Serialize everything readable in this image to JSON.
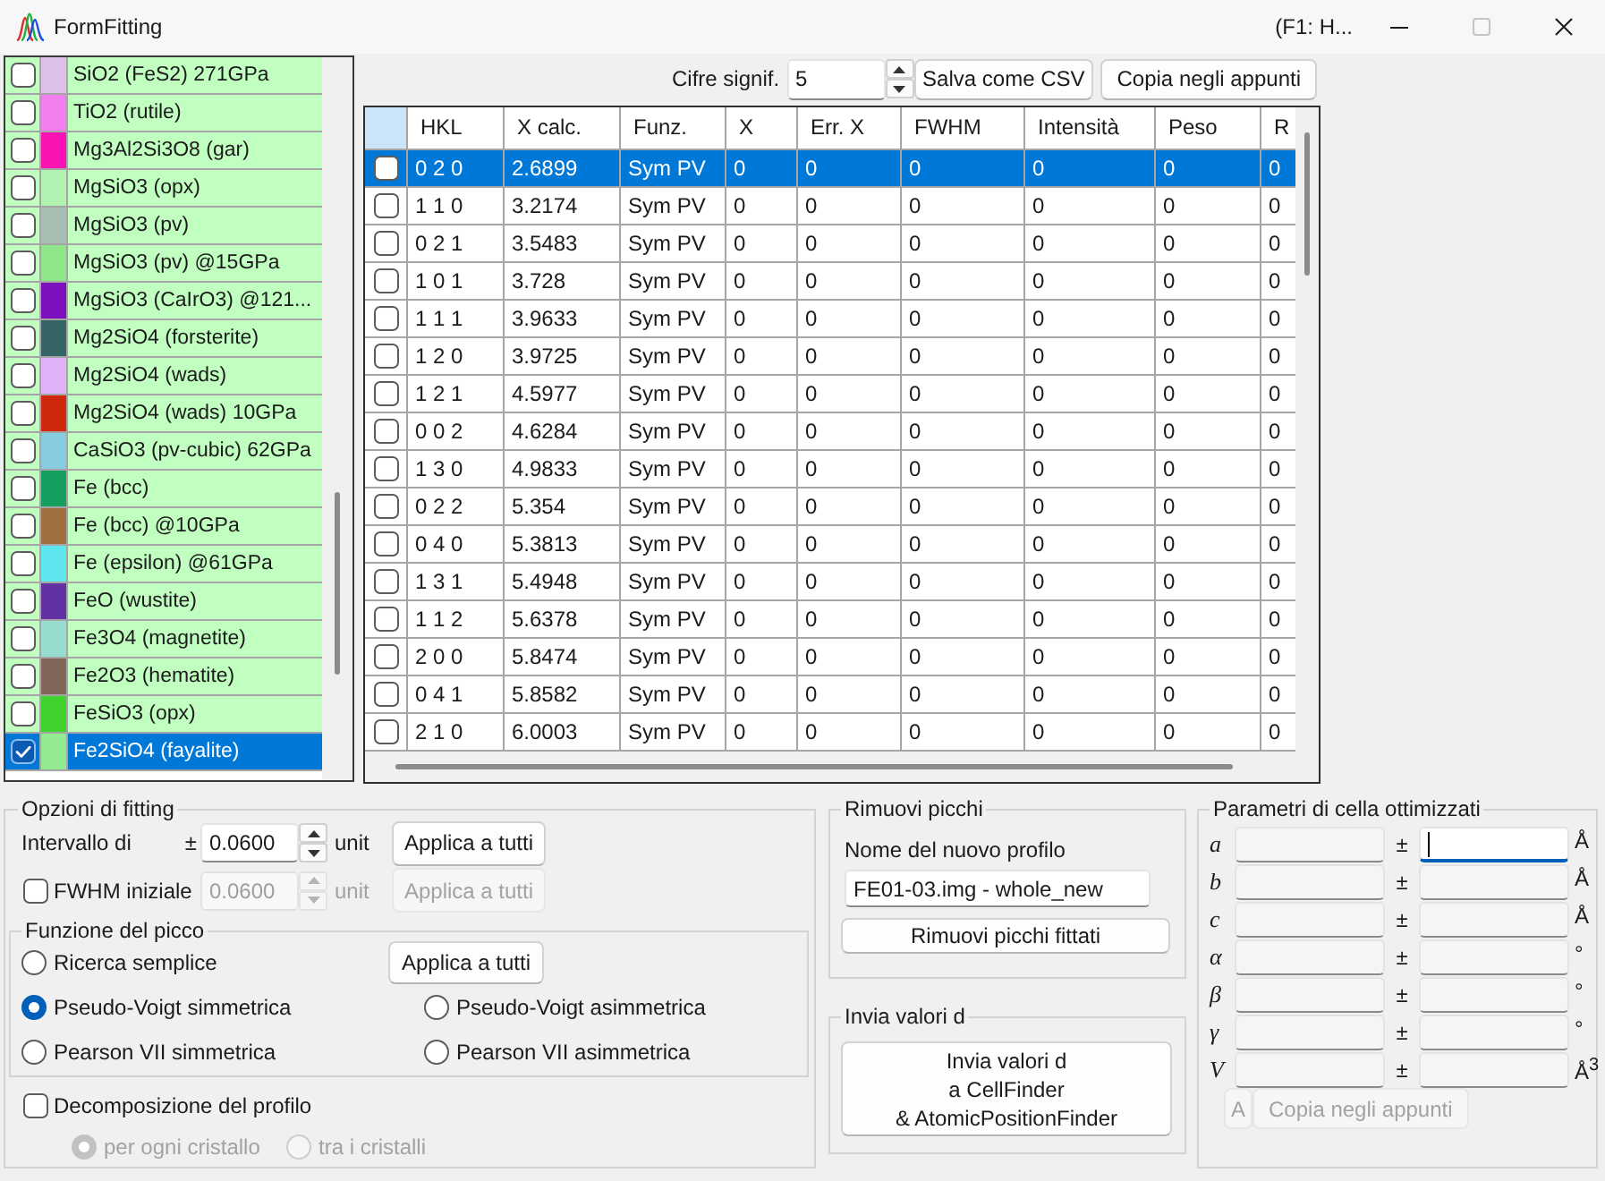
{
  "window": {
    "title": "FormFitting",
    "help_hint": "(F1: H...",
    "maximize_disabled": true
  },
  "crystal_list": {
    "items": [
      {
        "name": "SiO2 (FeS2) 271GPa",
        "color": "#dcc0e8",
        "checked": false,
        "selected": false
      },
      {
        "name": "TiO2 (rutile)",
        "color": "#f27ff0",
        "checked": false,
        "selected": false
      },
      {
        "name": "Mg3Al2Si3O8 (gar)",
        "color": "#fa14b4",
        "checked": false,
        "selected": false
      },
      {
        "name": "MgSiO3 (opx)",
        "color": "#b2f2b0",
        "checked": false,
        "selected": false
      },
      {
        "name": "MgSiO3 (pv)",
        "color": "#a6beb2",
        "checked": false,
        "selected": false
      },
      {
        "name": "MgSiO3 (pv) @15GPa",
        "color": "#90e68a",
        "checked": false,
        "selected": false
      },
      {
        "name": "MgSiO3 (CaIrO3) @121...",
        "color": "#7c10bc",
        "checked": false,
        "selected": false
      },
      {
        "name": "Mg2SiO4 (forsterite)",
        "color": "#346464",
        "checked": false,
        "selected": false
      },
      {
        "name": "Mg2SiO4 (wads)",
        "color": "#e2b2f8",
        "checked": false,
        "selected": false
      },
      {
        "name": "Mg2SiO4 (wads) 10GPa",
        "color": "#d0280c",
        "checked": false,
        "selected": false
      },
      {
        "name": "CaSiO3 (pv-cubic) 62GPa",
        "color": "#86cce0",
        "checked": false,
        "selected": false
      },
      {
        "name": "Fe (bcc)",
        "color": "#16a060",
        "checked": false,
        "selected": false
      },
      {
        "name": "Fe (bcc) @10GPa",
        "color": "#a07040",
        "checked": false,
        "selected": false
      },
      {
        "name": "Fe (epsilon) @61GPa",
        "color": "#5ee6ee",
        "checked": false,
        "selected": false
      },
      {
        "name": "FeO (wustite)",
        "color": "#6232a2",
        "checked": false,
        "selected": false
      },
      {
        "name": "Fe3O4 (magnetite)",
        "color": "#98dcd0",
        "checked": false,
        "selected": false
      },
      {
        "name": "Fe2O3 (hematite)",
        "color": "#82665a",
        "checked": false,
        "selected": false
      },
      {
        "name": "FeSiO3 (opx)",
        "color": "#40d22c",
        "checked": false,
        "selected": false
      },
      {
        "name": "Fe2SiO4 (fayalite)",
        "color": "#92ea92",
        "checked": true,
        "selected": true
      }
    ]
  },
  "table_toolbar": {
    "digits_label": "Cifre signif.",
    "digits_value": "5",
    "buttons": [
      {
        "label": "Salva come CSV",
        "disabled": false
      },
      {
        "label": "Copia negli appunti",
        "disabled": false
      }
    ]
  },
  "peak_table": {
    "columns": [
      "HKL",
      "X calc.",
      "Funz.",
      "X",
      "Err. X",
      "FWHM",
      "Intensità",
      "Peso",
      "R"
    ],
    "rows": [
      {
        "checked": false,
        "selected": true,
        "cells": [
          "0 2 0",
          "2.6899",
          "Sym PV",
          "0",
          "0",
          "0",
          "0",
          "0",
          "0"
        ]
      },
      {
        "checked": false,
        "selected": false,
        "cells": [
          "1 1 0",
          "3.2174",
          "Sym PV",
          "0",
          "0",
          "0",
          "0",
          "0",
          "0"
        ]
      },
      {
        "checked": false,
        "selected": false,
        "cells": [
          "0 2 1",
          "3.5483",
          "Sym PV",
          "0",
          "0",
          "0",
          "0",
          "0",
          "0"
        ]
      },
      {
        "checked": false,
        "selected": false,
        "cells": [
          "1 0 1",
          "3.728",
          "Sym PV",
          "0",
          "0",
          "0",
          "0",
          "0",
          "0"
        ]
      },
      {
        "checked": false,
        "selected": false,
        "cells": [
          "1 1 1",
          "3.9633",
          "Sym PV",
          "0",
          "0",
          "0",
          "0",
          "0",
          "0"
        ]
      },
      {
        "checked": false,
        "selected": false,
        "cells": [
          "1 2 0",
          "3.9725",
          "Sym PV",
          "0",
          "0",
          "0",
          "0",
          "0",
          "0"
        ]
      },
      {
        "checked": false,
        "selected": false,
        "cells": [
          "1 2 1",
          "4.5977",
          "Sym PV",
          "0",
          "0",
          "0",
          "0",
          "0",
          "0"
        ]
      },
      {
        "checked": false,
        "selected": false,
        "cells": [
          "0 0 2",
          "4.6284",
          "Sym PV",
          "0",
          "0",
          "0",
          "0",
          "0",
          "0"
        ]
      },
      {
        "checked": false,
        "selected": false,
        "cells": [
          "1 3 0",
          "4.9833",
          "Sym PV",
          "0",
          "0",
          "0",
          "0",
          "0",
          "0"
        ]
      },
      {
        "checked": false,
        "selected": false,
        "cells": [
          "0 2 2",
          "5.354",
          "Sym PV",
          "0",
          "0",
          "0",
          "0",
          "0",
          "0"
        ]
      },
      {
        "checked": false,
        "selected": false,
        "cells": [
          "0 4 0",
          "5.3813",
          "Sym PV",
          "0",
          "0",
          "0",
          "0",
          "0",
          "0"
        ]
      },
      {
        "checked": false,
        "selected": false,
        "cells": [
          "1 3 1",
          "5.4948",
          "Sym PV",
          "0",
          "0",
          "0",
          "0",
          "0",
          "0"
        ]
      },
      {
        "checked": false,
        "selected": false,
        "cells": [
          "1 1 2",
          "5.6378",
          "Sym PV",
          "0",
          "0",
          "0",
          "0",
          "0",
          "0"
        ]
      },
      {
        "checked": false,
        "selected": false,
        "cells": [
          "2 0 0",
          "5.8474",
          "Sym PV",
          "0",
          "0",
          "0",
          "0",
          "0",
          "0"
        ]
      },
      {
        "checked": false,
        "selected": false,
        "cells": [
          "0 4 1",
          "5.8582",
          "Sym PV",
          "0",
          "0",
          "0",
          "0",
          "0",
          "0"
        ]
      },
      {
        "checked": false,
        "selected": false,
        "cells": [
          "2 1 0",
          "6.0003",
          "Sym PV",
          "0",
          "0",
          "0",
          "0",
          "0",
          "0"
        ]
      }
    ]
  },
  "fitting_options": {
    "title": "Opzioni di fitting",
    "search_range": {
      "label": "Intervallo di",
      "sign": "±",
      "value": "0.0600",
      "unit": "unit",
      "button": {
        "label": "Applica a tutti",
        "disabled": false
      }
    },
    "initial_fwhm": {
      "label": "FWHM iniziale",
      "checked": false,
      "disabled": true,
      "value": "0.0600",
      "unit": "unit",
      "button": {
        "label": "Applica a tutti",
        "disabled": true
      }
    },
    "peak_function": {
      "title": "Funzione del picco",
      "button": {
        "label": "Applica a tutti",
        "disabled": false
      },
      "options": [
        {
          "label": "Ricerca semplice",
          "selected": false
        },
        {
          "label": "Pseudo-Voigt simmetrica",
          "selected": true
        },
        {
          "label": "Pseudo-Voigt asimmetrica",
          "selected": false
        },
        {
          "label": "Pearson VII simmetrica",
          "selected": false
        },
        {
          "label": "Pearson VII asimmetrica",
          "selected": false
        }
      ]
    },
    "profile_decomposition": {
      "label": "Decomposizione del profilo",
      "checked": false,
      "options": [
        {
          "label": "per ogni cristallo",
          "selected": true,
          "disabled": true
        },
        {
          "label": "tra i cristalli",
          "selected": false,
          "disabled": true
        }
      ]
    }
  },
  "remove_peaks": {
    "title": "Rimuovi picchi",
    "name_label": "Nome del nuovo profilo",
    "name_value": "FE01-03.img - whole_new",
    "button": {
      "label": "Rimuovi picchi fittati",
      "disabled": false
    }
  },
  "send_d_values": {
    "title": "Invia valori d",
    "button": {
      "lines": [
        "Invia valori d",
        "a CellFinder",
        "& AtomicPositionFinder"
      ],
      "disabled": false
    }
  },
  "cell_parameters": {
    "title": "Parametri di cella ottimizzati",
    "rows": [
      {
        "symbol": "a",
        "sign": "±",
        "unit": "Å",
        "error_focused": true
      },
      {
        "symbol": "b",
        "sign": "±",
        "unit": "Å",
        "error_focused": false
      },
      {
        "symbol": "c",
        "sign": "±",
        "unit": "Å",
        "error_focused": false
      },
      {
        "symbol": "α",
        "sign": "±",
        "unit": "°",
        "error_focused": false
      },
      {
        "symbol": "β",
        "sign": "±",
        "unit": "°",
        "error_focused": false
      },
      {
        "symbol": "γ",
        "sign": "±",
        "unit": "°",
        "error_focused": false
      },
      {
        "symbol": "V",
        "sign": "±",
        "unit": "Å$^{3}$",
        "error_focused": false
      }
    ],
    "buttons": [
      {
        "label": "A",
        "disabled": true
      },
      {
        "label": "Copia negli appunti",
        "disabled": true
      }
    ]
  }
}
